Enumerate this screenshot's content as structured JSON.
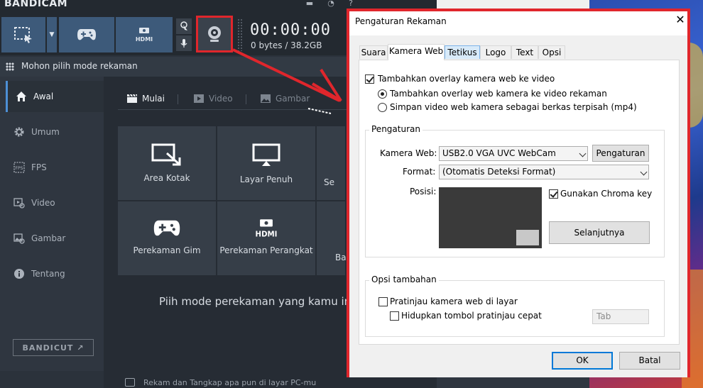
{
  "app": {
    "brand": "BANDICAM",
    "timer": "00:00:00",
    "storage": "0 bytes / 38.2GB",
    "mode_prompt": "Mohon pilih mode rekaman",
    "bandicut_label": "BANDICUT ↗",
    "hint": "Piih mode perekaman yang kamu ingin p",
    "status": "Rekam dan Tangkap apa pun di layar PC-mu",
    "sidebar": [
      {
        "label": "Awal",
        "icon": "home-icon"
      },
      {
        "label": "Umum",
        "icon": "gear-icon"
      },
      {
        "label": "FPS",
        "icon": "fps-icon"
      },
      {
        "label": "Video",
        "icon": "video-icon"
      },
      {
        "label": "Gambar",
        "icon": "image-icon"
      },
      {
        "label": "Tentang",
        "icon": "info-icon"
      }
    ],
    "content_tabs": [
      {
        "label": "Mulai",
        "icon": "clapper-icon"
      },
      {
        "label": "Video",
        "icon": "video-icon"
      },
      {
        "label": "Gambar",
        "icon": "image-icon"
      }
    ],
    "tiles": [
      {
        "label": "Area Kotak",
        "icon": "area-select-icon"
      },
      {
        "label": "Layar Penuh",
        "icon": "monitor-icon"
      },
      {
        "label": "Se",
        "icon": "cursor-area-icon"
      },
      {
        "label": "Perekaman Gim",
        "icon": "gamepad-icon"
      },
      {
        "label": "Perekaman Perangkat",
        "icon": "hdmi-icon"
      },
      {
        "label": "Ba",
        "icon": "audio-icon"
      }
    ]
  },
  "dialog": {
    "title": "Pengaturan Rekaman",
    "close": "✕",
    "tabs": [
      "Suara",
      "Kamera Web",
      "Tetikus",
      "Logo",
      "Text",
      "Opsi"
    ],
    "overlay_checkbox": "Tambahkan overlay kamera web ke video",
    "radio_overlay": "Tambahkan overlay web kamera ke video rekaman",
    "radio_separate": "Simpan video web kamera sebagai berkas terpisah (mp4)",
    "settings_group": "Pengaturan",
    "webcam_label": "Kamera Web:",
    "webcam_value": "USB2.0 VGA UVC WebCam",
    "webcam_settings_button": "Pengaturan",
    "format_label": "Format:",
    "format_value": "(Otomatis Deteksi Format)",
    "position_label": "Posisi:",
    "chroma_key": "Gunakan Chroma key",
    "next_button": "Selanjutnya",
    "extra_group": "Opsi tambahan",
    "preview_checkbox": "Pratinjau kamera web di layar",
    "hotkey_checkbox": "Hidupkan tombol pratinjau cepat",
    "hotkey_value": "Tab",
    "ok": "OK",
    "cancel": "Batal"
  },
  "colors": {
    "highlight": "#e0262c",
    "toolbar_button": "#3d5a7a",
    "accent": "#4d8fd6"
  }
}
